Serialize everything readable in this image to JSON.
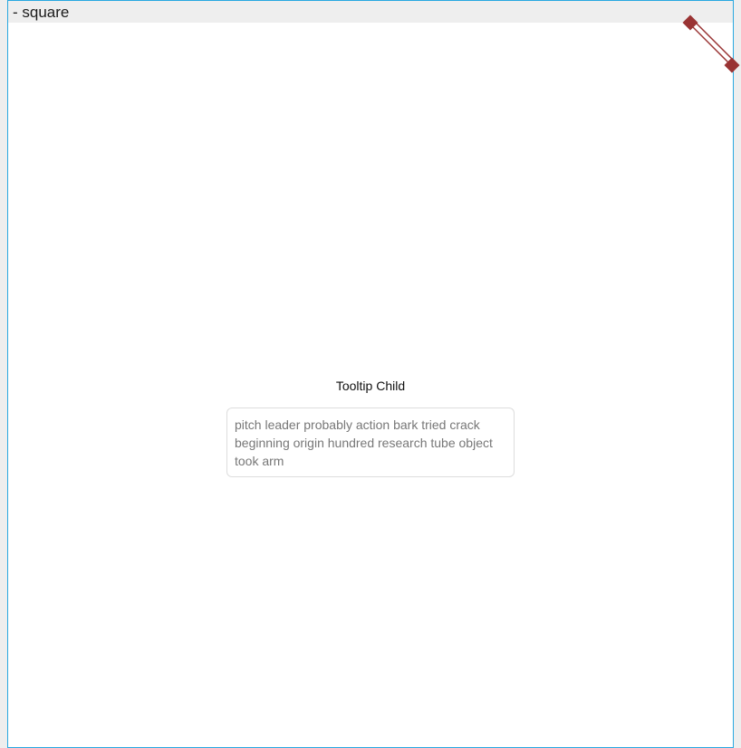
{
  "window": {
    "title": "- square"
  },
  "tooltip": {
    "label": "Tooltip Child",
    "content": "pitch leader probably action bark tried crack beginning origin hundred research tube object took arm"
  },
  "colors": {
    "frame_border": "#29a8e0",
    "title_bar_bg": "#eeeeee",
    "handle": "#993333"
  },
  "icons": {
    "resize_handle": "diagonal-resize-handle-icon"
  }
}
